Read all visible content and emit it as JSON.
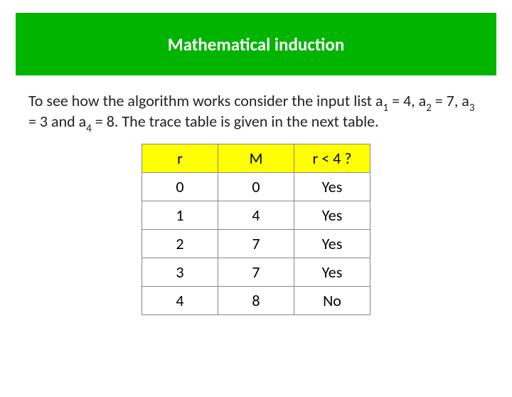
{
  "banner": {
    "title": "Mathematical induction"
  },
  "paragraph": {
    "intro": "To see how the algorithm works consider the input list a",
    "sub1": "1",
    "eq1": " = 4, a",
    "sub2": "2",
    "eq2": " = 7, a",
    "sub3": "3",
    "eq3": " = 3 and a",
    "sub4": "4",
    "eq4": " = 8. The trace table is given in the next table."
  },
  "table": {
    "headers": [
      "r",
      "M",
      "r < 4 ?"
    ],
    "rows": [
      [
        "0",
        "0",
        "Yes"
      ],
      [
        "1",
        "4",
        "Yes"
      ],
      [
        "2",
        "7",
        "Yes"
      ],
      [
        "3",
        "7",
        "Yes"
      ],
      [
        "4",
        "8",
        "No"
      ]
    ]
  }
}
